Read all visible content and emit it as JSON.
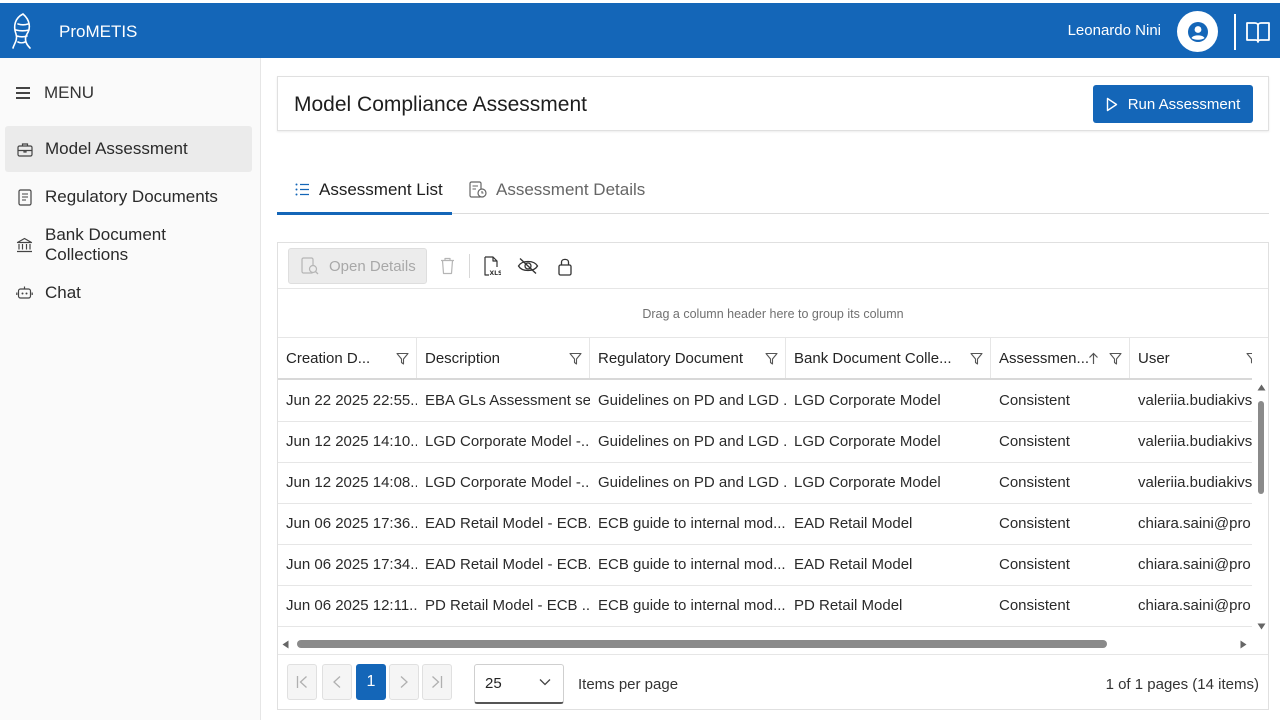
{
  "header": {
    "app_name": "ProMETIS",
    "user_name": "Leonardo Nini",
    "icons": [
      "logo-icon",
      "user-avatar-icon",
      "book-icon"
    ],
    "brand_color": "#1466b8"
  },
  "sidebar": {
    "menu_label": "MENU",
    "items": [
      {
        "label": "Model Assessment",
        "icon": "briefcase-icon",
        "active": true
      },
      {
        "label": "Regulatory Documents",
        "icon": "document-icon",
        "active": false
      },
      {
        "label": "Bank Document Collections",
        "icon": "bank-icon",
        "active": false
      },
      {
        "label": "Chat",
        "icon": "chat-bot-icon",
        "active": false
      }
    ]
  },
  "page": {
    "title": "Model Compliance Assessment",
    "run_button": "Run Assessment"
  },
  "tabs": [
    {
      "label": "Assessment List",
      "active": true
    },
    {
      "label": "Assessment Details",
      "active": false
    }
  ],
  "toolbar": {
    "open_details": "Open Details",
    "icons": [
      "delete-icon",
      "export-xls-icon",
      "hide-columns-icon",
      "lock-icon"
    ]
  },
  "grid": {
    "group_panel_hint": "Drag a column header here to group its column",
    "columns": [
      "Creation D...",
      "Description",
      "Regulatory Document",
      "Bank Document Colle...",
      "Assessmen...",
      "User"
    ],
    "rows": [
      [
        "Jun 22 2025 22:55...",
        "EBA GLs Assessment se...",
        "Guidelines on PD and LGD ...",
        "LGD Corporate Model",
        "Consistent",
        "valeriia.budiakivsk..."
      ],
      [
        "Jun 12 2025 14:10...",
        "LGD Corporate Model -...",
        "Guidelines on PD and LGD ...",
        "LGD Corporate Model",
        "Consistent",
        "valeriia.budiakivsk..."
      ],
      [
        "Jun 12 2025 14:08...",
        "LGD Corporate Model -...",
        "Guidelines on PD and LGD ...",
        "LGD Corporate Model",
        "Consistent",
        "valeriia.budiakivsk..."
      ],
      [
        "Jun 06 2025 17:36...",
        "EAD Retail Model - ECB...",
        "ECB guide to internal mod...",
        "EAD Retail Model",
        "Consistent",
        "chiara.saini@pro..."
      ],
      [
        "Jun 06 2025 17:34...",
        "EAD Retail Model - ECB...",
        "ECB guide to internal mod...",
        "EAD Retail Model",
        "Consistent",
        "chiara.saini@pro..."
      ],
      [
        "Jun 06 2025 12:11...",
        "PD Retail Model - ECB ...",
        "ECB guide to internal mod...",
        "PD Retail Model",
        "Consistent",
        "chiara.saini@pro..."
      ]
    ]
  },
  "pager": {
    "current_page": "1",
    "page_size": "25",
    "items_per_page_label": "Items per page",
    "info": "1 of 1 pages (14 items)"
  }
}
